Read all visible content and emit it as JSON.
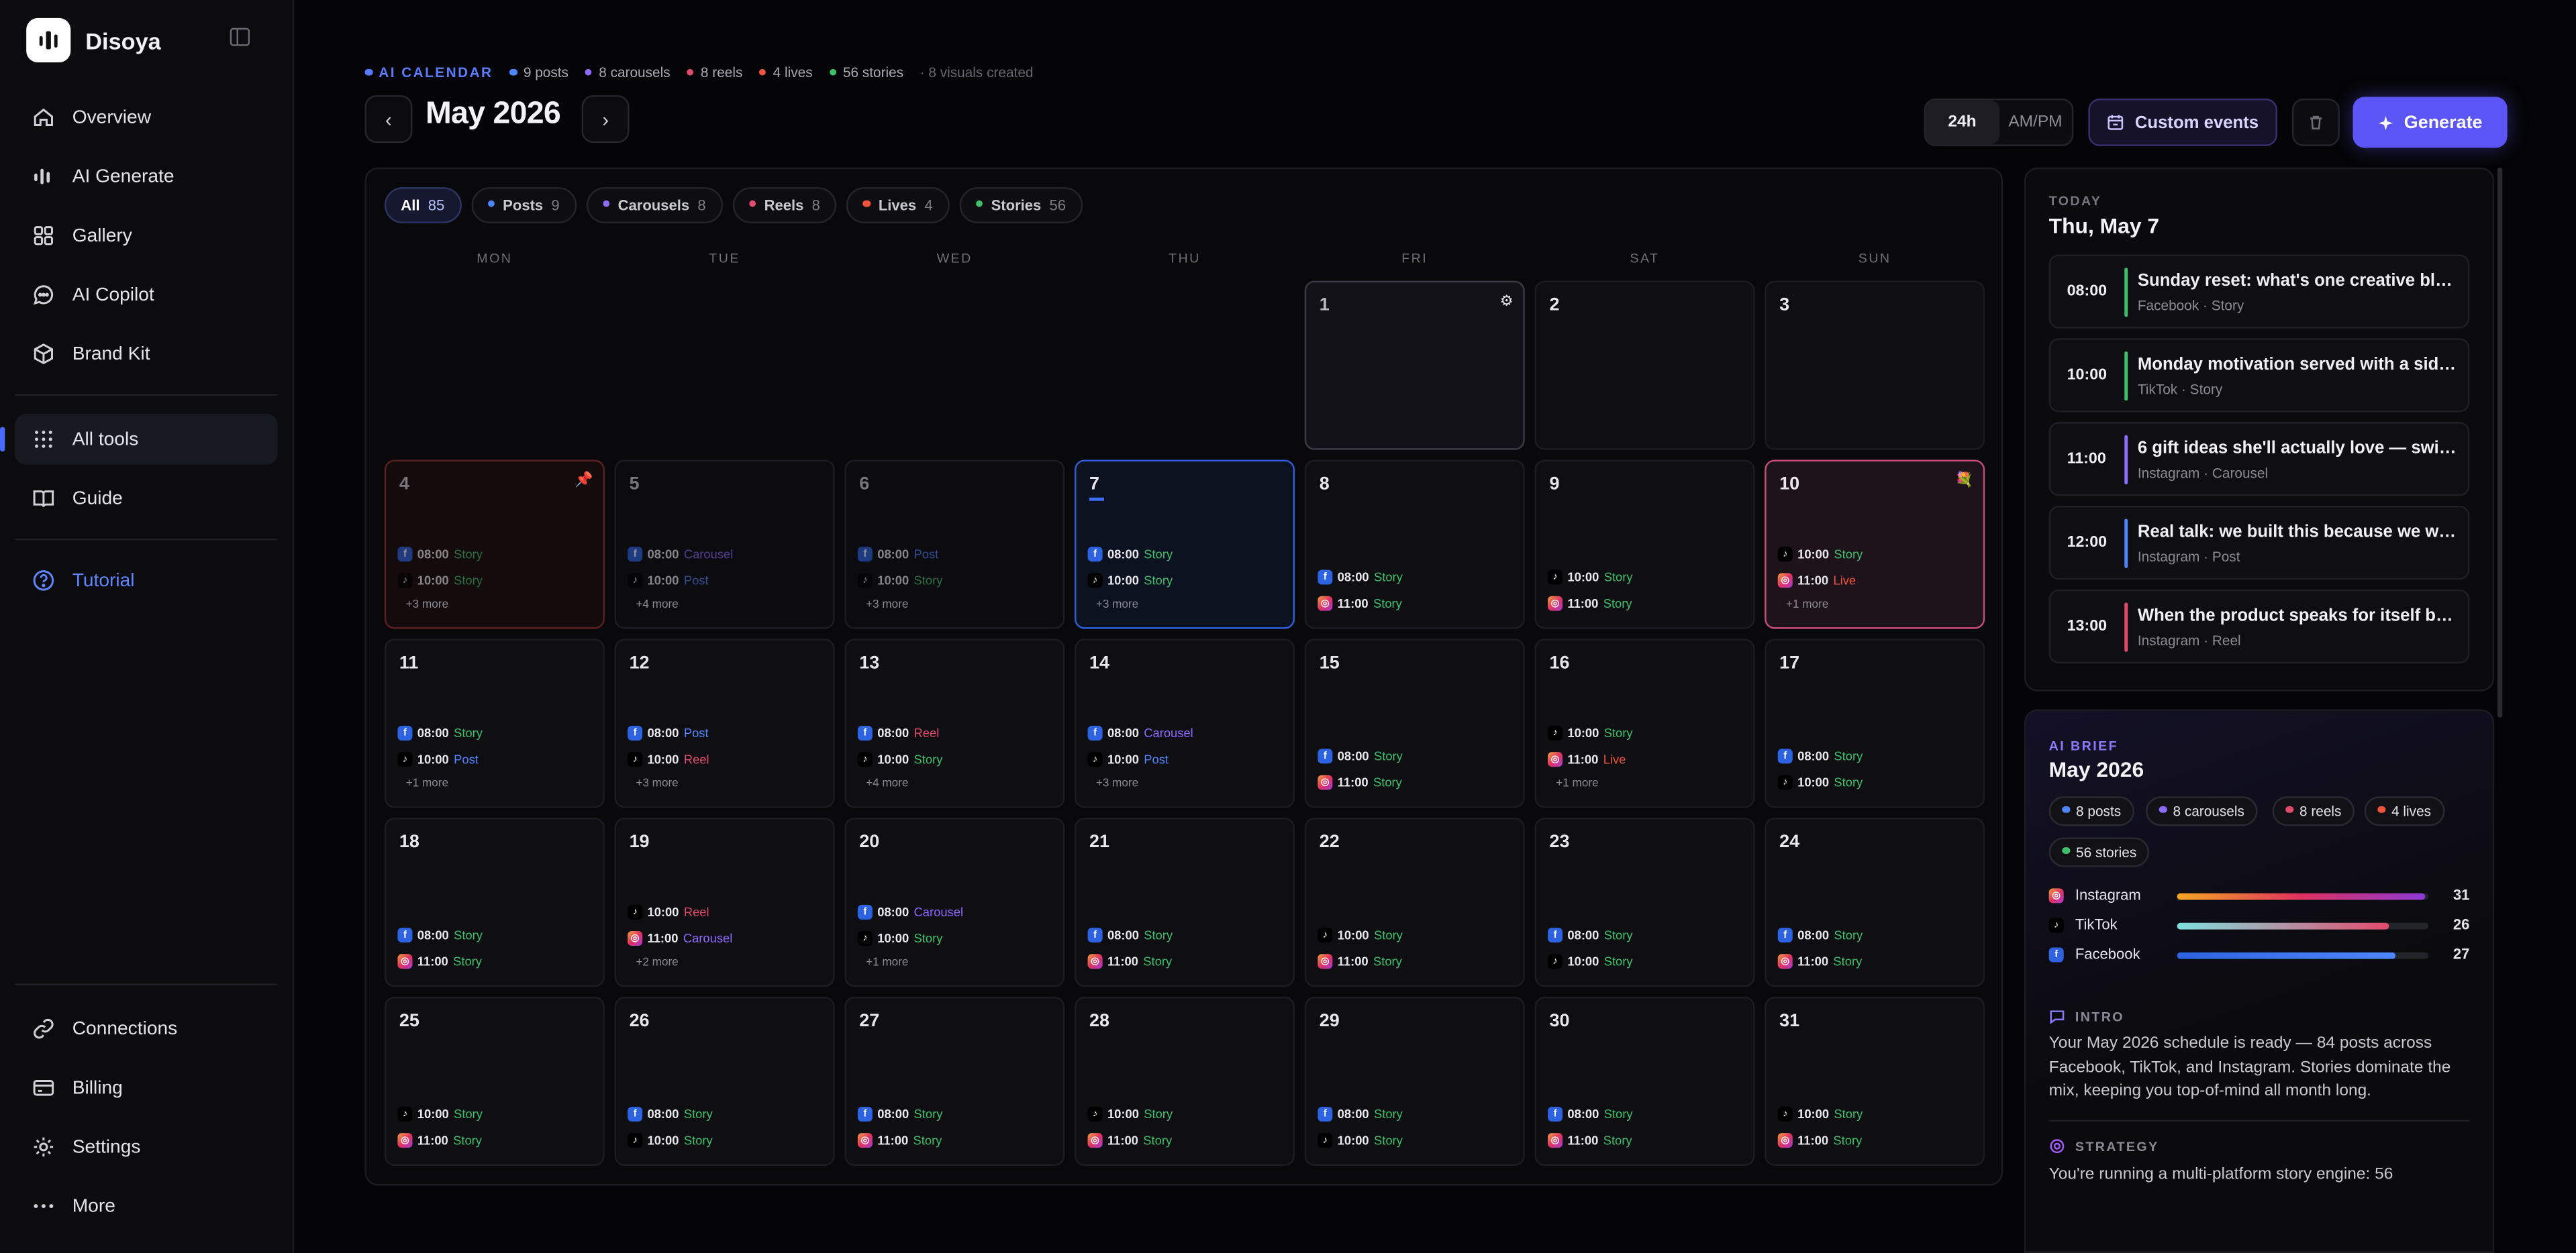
{
  "sidebar": {
    "brand": "Disoya",
    "nav": [
      {
        "label": "Overview"
      },
      {
        "label": "AI Generate"
      },
      {
        "label": "Gallery"
      },
      {
        "label": "AI Copilot"
      },
      {
        "label": "Brand Kit"
      },
      {
        "label": "All tools"
      },
      {
        "label": "Guide"
      },
      {
        "label": "Tutorial"
      }
    ],
    "bottom": [
      {
        "label": "Connections"
      },
      {
        "label": "Billing"
      },
      {
        "label": "Settings"
      },
      {
        "label": "More"
      }
    ]
  },
  "header": {
    "tag": "AI CALENDAR",
    "stats": [
      {
        "text": "9 posts",
        "color": "#4f86ff"
      },
      {
        "text": "8 carousels",
        "color": "#8b6cff"
      },
      {
        "text": "8 reels",
        "color": "#e24b6c"
      },
      {
        "text": "4 lives",
        "color": "#f0533c"
      },
      {
        "text": "56 stories",
        "color": "#3fc06b"
      }
    ],
    "visuals": "· 8 visuals created",
    "month": "May 2026",
    "prev": "‹",
    "next": "›",
    "toggle_24": "24h",
    "toggle_ampm": "AM/PM",
    "custom_events": "Custom events",
    "generate": "Generate"
  },
  "filters": [
    {
      "label": "All",
      "count": "85"
    },
    {
      "label": "Posts",
      "count": "9",
      "color": "#4f86ff"
    },
    {
      "label": "Carousels",
      "count": "8",
      "color": "#8b6cff"
    },
    {
      "label": "Reels",
      "count": "8",
      "color": "#e24b6c"
    },
    {
      "label": "Lives",
      "count": "4",
      "color": "#f0533c"
    },
    {
      "label": "Stories",
      "count": "56",
      "color": "#3fc06b"
    }
  ],
  "weekdays": [
    "MON",
    "TUE",
    "WED",
    "THU",
    "FRI",
    "SAT",
    "SUN"
  ],
  "days": [
    {
      "d": "1",
      "col": 4,
      "row": 0,
      "style": "day1",
      "icon": "⚙",
      "events": []
    },
    {
      "d": "2",
      "col": 5,
      "row": 0,
      "events": []
    },
    {
      "d": "3",
      "col": 6,
      "row": 0,
      "events": []
    },
    {
      "d": "4",
      "col": 0,
      "row": 1,
      "style": "red",
      "icon": "📌",
      "past": true,
      "events": [
        {
          "p": "fb",
          "t": "08:00",
          "k": "Story"
        },
        {
          "p": "tt",
          "t": "10:00",
          "k": "Story"
        }
      ],
      "more": "+3 more"
    },
    {
      "d": "5",
      "col": 1,
      "row": 1,
      "past": true,
      "events": [
        {
          "p": "fb",
          "t": "08:00",
          "k": "Carousel"
        },
        {
          "p": "tt",
          "t": "10:00",
          "k": "Post"
        }
      ],
      "more": "+4 more"
    },
    {
      "d": "6",
      "col": 2,
      "row": 1,
      "past": true,
      "events": [
        {
          "p": "fb",
          "t": "08:00",
          "k": "Post"
        },
        {
          "p": "tt",
          "t": "10:00",
          "k": "Story"
        }
      ],
      "more": "+3 more"
    },
    {
      "d": "7",
      "col": 3,
      "row": 1,
      "style": "today",
      "events": [
        {
          "p": "fb",
          "t": "08:00",
          "k": "Story"
        },
        {
          "p": "tt",
          "t": "10:00",
          "k": "Story"
        }
      ],
      "more": "+3 more"
    },
    {
      "d": "8",
      "col": 4,
      "row": 1,
      "events": [
        {
          "p": "fb",
          "t": "08:00",
          "k": "Story"
        },
        {
          "p": "ig",
          "t": "11:00",
          "k": "Story"
        }
      ]
    },
    {
      "d": "9",
      "col": 5,
      "row": 1,
      "events": [
        {
          "p": "tt",
          "t": "10:00",
          "k": "Story"
        },
        {
          "p": "ig",
          "t": "11:00",
          "k": "Story"
        }
      ]
    },
    {
      "d": "10",
      "col": 6,
      "row": 1,
      "style": "pink",
      "icon": "💐",
      "events": [
        {
          "p": "tt",
          "t": "10:00",
          "k": "Story"
        },
        {
          "p": "ig",
          "t": "11:00",
          "k": "Live"
        }
      ],
      "more": "+1 more"
    },
    {
      "d": "11",
      "col": 0,
      "row": 2,
      "events": [
        {
          "p": "fb",
          "t": "08:00",
          "k": "Story"
        },
        {
          "p": "tt",
          "t": "10:00",
          "k": "Post"
        }
      ],
      "more": "+1 more"
    },
    {
      "d": "12",
      "col": 1,
      "row": 2,
      "events": [
        {
          "p": "fb",
          "t": "08:00",
          "k": "Post"
        },
        {
          "p": "tt",
          "t": "10:00",
          "k": "Reel"
        }
      ],
      "more": "+3 more"
    },
    {
      "d": "13",
      "col": 2,
      "row": 2,
      "events": [
        {
          "p": "fb",
          "t": "08:00",
          "k": "Reel"
        },
        {
          "p": "tt",
          "t": "10:00",
          "k": "Story"
        }
      ],
      "more": "+4 more"
    },
    {
      "d": "14",
      "col": 3,
      "row": 2,
      "events": [
        {
          "p": "fb",
          "t": "08:00",
          "k": "Carousel"
        },
        {
          "p": "tt",
          "t": "10:00",
          "k": "Post"
        }
      ],
      "more": "+3 more"
    },
    {
      "d": "15",
      "col": 4,
      "row": 2,
      "events": [
        {
          "p": "fb",
          "t": "08:00",
          "k": "Story"
        },
        {
          "p": "ig",
          "t": "11:00",
          "k": "Story"
        }
      ]
    },
    {
      "d": "16",
      "col": 5,
      "row": 2,
      "events": [
        {
          "p": "tt",
          "t": "10:00",
          "k": "Story"
        },
        {
          "p": "ig",
          "t": "11:00",
          "k": "Live"
        }
      ],
      "more": "+1 more"
    },
    {
      "d": "17",
      "col": 6,
      "row": 2,
      "events": [
        {
          "p": "fb",
          "t": "08:00",
          "k": "Story"
        },
        {
          "p": "tt",
          "t": "10:00",
          "k": "Story"
        }
      ]
    },
    {
      "d": "18",
      "col": 0,
      "row": 3,
      "events": [
        {
          "p": "fb",
          "t": "08:00",
          "k": "Story"
        },
        {
          "p": "ig",
          "t": "11:00",
          "k": "Story"
        }
      ]
    },
    {
      "d": "19",
      "col": 1,
      "row": 3,
      "events": [
        {
          "p": "tt",
          "t": "10:00",
          "k": "Reel"
        },
        {
          "p": "ig",
          "t": "11:00",
          "k": "Carousel"
        }
      ],
      "more": "+2 more"
    },
    {
      "d": "20",
      "col": 2,
      "row": 3,
      "events": [
        {
          "p": "fb",
          "t": "08:00",
          "k": "Carousel"
        },
        {
          "p": "tt",
          "t": "10:00",
          "k": "Story"
        }
      ],
      "more": "+1 more"
    },
    {
      "d": "21",
      "col": 3,
      "row": 3,
      "events": [
        {
          "p": "fb",
          "t": "08:00",
          "k": "Story"
        },
        {
          "p": "ig",
          "t": "11:00",
          "k": "Story"
        }
      ]
    },
    {
      "d": "22",
      "col": 4,
      "row": 3,
      "events": [
        {
          "p": "tt",
          "t": "10:00",
          "k": "Story"
        },
        {
          "p": "ig",
          "t": "11:00",
          "k": "Story"
        }
      ]
    },
    {
      "d": "23",
      "col": 5,
      "row": 3,
      "events": [
        {
          "p": "fb",
          "t": "08:00",
          "k": "Story"
        },
        {
          "p": "tt",
          "t": "10:00",
          "k": "Story"
        }
      ]
    },
    {
      "d": "24",
      "col": 6,
      "row": 3,
      "events": [
        {
          "p": "fb",
          "t": "08:00",
          "k": "Story"
        },
        {
          "p": "ig",
          "t": "11:00",
          "k": "Story"
        }
      ]
    },
    {
      "d": "25",
      "col": 0,
      "row": 4,
      "events": [
        {
          "p": "tt",
          "t": "10:00",
          "k": "Story"
        },
        {
          "p": "ig",
          "t": "11:00",
          "k": "Story"
        }
      ]
    },
    {
      "d": "26",
      "col": 1,
      "row": 4,
      "events": [
        {
          "p": "fb",
          "t": "08:00",
          "k": "Story"
        },
        {
          "p": "tt",
          "t": "10:00",
          "k": "Story"
        }
      ]
    },
    {
      "d": "27",
      "col": 2,
      "row": 4,
      "events": [
        {
          "p": "fb",
          "t": "08:00",
          "k": "Story"
        },
        {
          "p": "ig",
          "t": "11:00",
          "k": "Story"
        }
      ]
    },
    {
      "d": "28",
      "col": 3,
      "row": 4,
      "events": [
        {
          "p": "tt",
          "t": "10:00",
          "k": "Story"
        },
        {
          "p": "ig",
          "t": "11:00",
          "k": "Story"
        }
      ]
    },
    {
      "d": "29",
      "col": 4,
      "row": 4,
      "events": [
        {
          "p": "fb",
          "t": "08:00",
          "k": "Story"
        },
        {
          "p": "tt",
          "t": "10:00",
          "k": "Story"
        }
      ]
    },
    {
      "d": "30",
      "col": 5,
      "row": 4,
      "events": [
        {
          "p": "fb",
          "t": "08:00",
          "k": "Story"
        },
        {
          "p": "ig",
          "t": "11:00",
          "k": "Story"
        }
      ]
    },
    {
      "d": "31",
      "col": 6,
      "row": 4,
      "events": [
        {
          "p": "tt",
          "t": "10:00",
          "k": "Story"
        },
        {
          "p": "ig",
          "t": "11:00",
          "k": "Story"
        }
      ]
    }
  ],
  "today": {
    "label": "TODAY",
    "date": "Thu, May 7",
    "events": [
      {
        "time": "08:00",
        "title": "Sunday reset: what's one creative blo…",
        "sub": "Facebook · Story",
        "color": "#3fc06b"
      },
      {
        "time": "10:00",
        "title": "Monday motivation served with a side…",
        "sub": "TikTok · Story",
        "color": "#3fc06b"
      },
      {
        "time": "11:00",
        "title": "6 gift ideas she'll actually love — swipe…",
        "sub": "Instagram · Carousel",
        "color": "#8b6cff"
      },
      {
        "time": "12:00",
        "title": "Real talk: we built this because we wer…",
        "sub": "Instagram · Post",
        "color": "#4f86ff"
      },
      {
        "time": "13:00",
        "title": "When the product speaks for itself but …",
        "sub": "Instagram · Reel",
        "color": "#e24b6c"
      }
    ]
  },
  "brief": {
    "label": "AI BRIEF",
    "title": "May 2026",
    "chips": [
      {
        "text": "8 posts",
        "color": "#4f86ff"
      },
      {
        "text": "8 carousels",
        "color": "#8b6cff"
      },
      {
        "text": "8 reels",
        "color": "#e24b6c"
      },
      {
        "text": "4 lives",
        "color": "#f0533c"
      },
      {
        "text": "56 stories",
        "color": "#3fc06b"
      }
    ],
    "platforms": [
      {
        "name": "Instagram",
        "value": "31",
        "fraction": 0.99
      },
      {
        "name": "TikTok",
        "value": "26",
        "fraction": 0.84
      },
      {
        "name": "Facebook",
        "value": "27",
        "fraction": 0.87
      }
    ],
    "intro_label": "INTRO",
    "intro": "Your May 2026 schedule is ready — 84 posts across Facebook, TikTok, and Instagram. Stories dominate the mix, keeping you top-of-mind all month long.",
    "strategy_label": "STRATEGY",
    "strategy": "You're running a multi-platform story engine: 56"
  }
}
